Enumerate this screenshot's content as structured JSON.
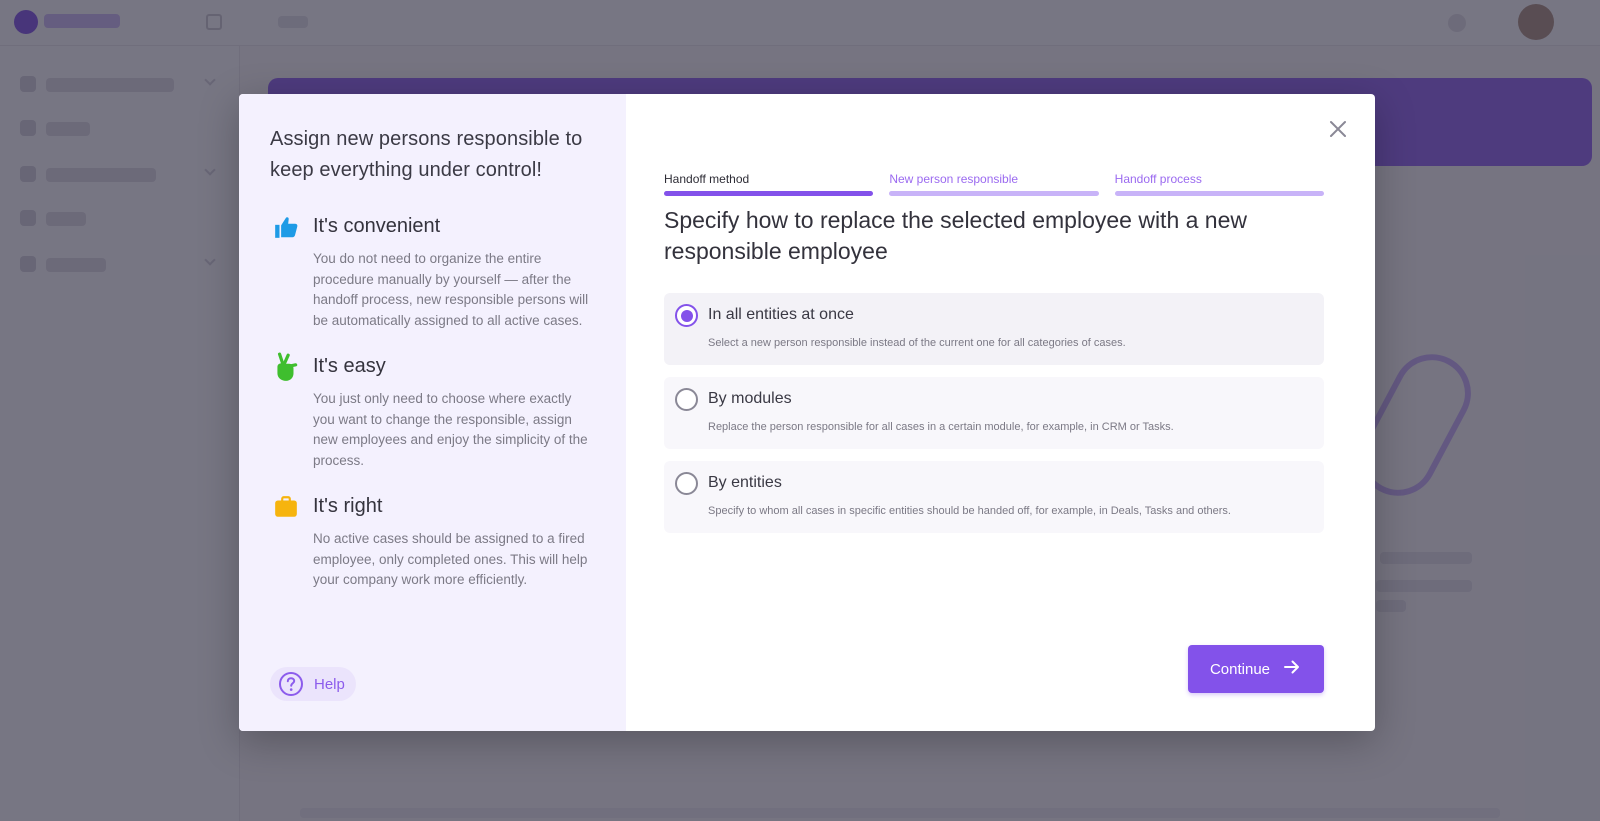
{
  "left_panel": {
    "title": "Assign new persons responsible to keep everything under control!",
    "features": [
      {
        "icon": "thumbs-up-icon",
        "title": "It's convenient",
        "text": "You do not need to organize the entire procedure manually by yourself — after the handoff process, new responsible persons will be automatically assigned to all active cases."
      },
      {
        "icon": "crossed-fingers-icon",
        "title": "It's easy",
        "text": "You just only need to choose where exactly you want to change the responsible, assign new employees and enjoy the simplicity of the process."
      },
      {
        "icon": "briefcase-icon",
        "title": "It's right",
        "text": "No active cases should be assigned to a fired employee, only completed ones. This will help your company work more efficiently."
      }
    ],
    "help_label": "Help"
  },
  "stepper": {
    "steps": [
      {
        "label": "Handoff method",
        "state": "active"
      },
      {
        "label": "New person responsible",
        "state": "upcoming"
      },
      {
        "label": "Handoff process",
        "state": "upcoming"
      }
    ]
  },
  "main": {
    "heading": "Specify how to replace the selected employee with a new responsible employee",
    "options": [
      {
        "title": "In all entities at once",
        "description": "Select a new person responsible instead of the current one for all categories of cases.",
        "selected": true
      },
      {
        "title": "By modules",
        "description": "Replace the person responsible for all cases in a certain module, for example, in CRM or Tasks.",
        "selected": false
      },
      {
        "title": "By entities",
        "description": "Specify to whom all cases in specific entities should be handed off, for example, in Deals, Tasks and others.",
        "selected": false
      }
    ],
    "continue_label": "Continue"
  },
  "colors": {
    "accent": "#8352ea",
    "left_panel_bg": "#f4f1fe",
    "thumbs_up": "#1e9be6",
    "crossed_fingers": "#3fbe2e",
    "briefcase": "#f6b40e"
  }
}
